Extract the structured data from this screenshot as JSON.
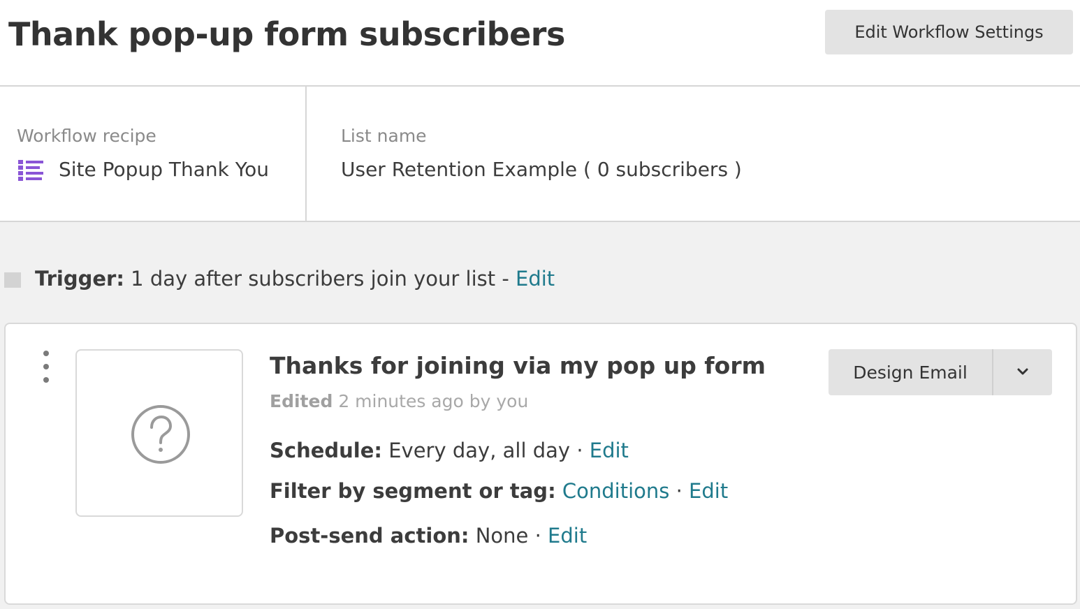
{
  "header": {
    "title": "Thank pop-up form subscribers",
    "settings_button": "Edit Workflow Settings"
  },
  "info": {
    "recipe_label": "Workflow recipe",
    "recipe_value": "Site Popup Thank You",
    "recipe_icon": "list-icon",
    "recipe_icon_color": "#8a55d6",
    "list_label": "List name",
    "list_value": "User Retention Example ( 0 subscribers )"
  },
  "trigger": {
    "label": "Trigger:",
    "text": "1 day after subscribers join your list -",
    "edit": "Edit"
  },
  "email": {
    "thumbnail_icon": "question-mark-icon",
    "title": "Thanks for joining via my pop up form",
    "edited_label": "Edited",
    "edited_text": "2 minutes ago by you",
    "schedule_label": "Schedule:",
    "schedule_value": "Every day, all day",
    "filter_label": "Filter by segment or tag:",
    "filter_value": "Conditions",
    "post_send_label": "Post-send action:",
    "post_send_value": "None",
    "separator": "·",
    "edit": "Edit",
    "design_button": "Design Email"
  },
  "colors": {
    "link": "#1f7a8c",
    "button_bg": "#e3e3e3",
    "workflow_bg": "#f1f1f1"
  }
}
